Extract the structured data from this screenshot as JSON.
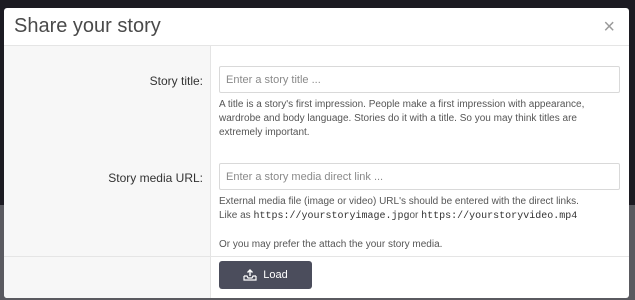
{
  "modal": {
    "title": "Share your story",
    "close_glyph": "×"
  },
  "form": {
    "title_label": "Story title:",
    "title_placeholder": "Enter a story title ...",
    "title_help": "A title is a story's first impression. People make a first impression with appearance, wardrobe and body language. Stories do it with a title. So you may think titles are extremely important.",
    "media_label": "Story media URL:",
    "media_placeholder": "Enter a story media direct link ...",
    "media_help_line1": "External media file (image or video) URL's should be entered with the direct links.",
    "media_help_like": "Like as ",
    "media_example_image": "https://yourstoryimage.jpg",
    "media_help_or": "or ",
    "media_example_video": "https://yourstoryvideo.mp4",
    "media_help_attach": "Or you may prefer the attach the your story media."
  },
  "footer": {
    "load_label": "Load"
  },
  "icons": {
    "close": "close-icon",
    "load": "upload-tray-icon"
  }
}
